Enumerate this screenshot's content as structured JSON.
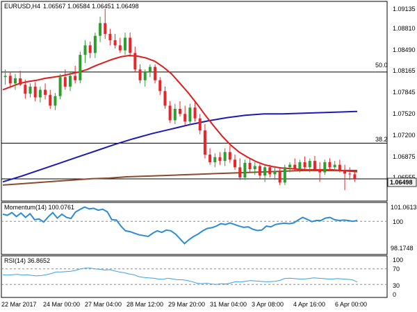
{
  "header": {
    "symbol": "EURUSD,H4",
    "ohlc": "1.06567 1.06584 1.06451 1.06498"
  },
  "colors": {
    "bull": "#2e9e2e",
    "bear": "#e8262a",
    "sma_fast": "#e01b1b",
    "sma_mid": "#1a1ab8",
    "sma_slow": "#8b4a2b",
    "indicator": "#2b8cd6",
    "rsi": "#3aa0e6",
    "price_box": "#f2f2f2"
  },
  "chart_data": [
    {
      "type": "candlestick",
      "title": "EURUSD,H4",
      "ylim": [
        1.0617,
        1.0927
      ],
      "y_ticks": [
        "1.09135",
        "1.08810",
        "1.08490",
        "1.08165",
        "1.07845",
        "1.07520",
        "1.07200",
        "1.06875",
        "1.06555"
      ],
      "current_price": "1.06498",
      "x_ticks": [
        "22 Mar 2017",
        "24 Mar 00:00",
        "27 Mar 04:00",
        "28 Mar 12:00",
        "29 Mar 20:00",
        "31 Mar 04:00",
        "3 Apr 08:00",
        "4 Apr 16:00",
        "6 Apr 00:00"
      ],
      "fib_levels": [
        {
          "label": "50.0",
          "value": 1.0818
        },
        {
          "label": "38.2",
          "value": 1.0706
        }
      ],
      "support_level": 1.06498,
      "candles": [
        [
          1.081,
          1.0822,
          1.0798,
          1.0812
        ],
        [
          1.0812,
          1.0818,
          1.0795,
          1.08
        ],
        [
          1.08,
          1.0815,
          1.079,
          1.0808
        ],
        [
          1.0808,
          1.082,
          1.0796,
          1.0798
        ],
        [
          1.0798,
          1.0806,
          1.0776,
          1.0784
        ],
        [
          1.0784,
          1.08,
          1.0778,
          1.0795
        ],
        [
          1.0795,
          1.0802,
          1.0772,
          1.0778
        ],
        [
          1.0778,
          1.0795,
          1.077,
          1.079
        ],
        [
          1.079,
          1.08,
          1.0775,
          1.0782
        ],
        [
          1.0782,
          1.079,
          1.076,
          1.0765
        ],
        [
          1.0765,
          1.0785,
          1.0758,
          1.078
        ],
        [
          1.078,
          1.0815,
          1.0775,
          1.081
        ],
        [
          1.081,
          1.0822,
          1.079,
          1.0795
        ],
        [
          1.0795,
          1.0818,
          1.0788,
          1.0812
        ],
        [
          1.0812,
          1.0828,
          1.08,
          1.0805
        ],
        [
          1.0805,
          1.085,
          1.08,
          1.0845
        ],
        [
          1.0845,
          1.0868,
          1.0832,
          1.086
        ],
        [
          1.086,
          1.0866,
          1.084,
          1.0848
        ],
        [
          1.0848,
          1.088,
          1.084,
          1.0875
        ],
        [
          1.0875,
          1.0905,
          1.0865,
          1.0895
        ],
        [
          1.0895,
          1.0918,
          1.087,
          1.0878
        ],
        [
          1.0878,
          1.0886,
          1.086,
          1.0868
        ],
        [
          1.0868,
          1.0878,
          1.0855,
          1.086
        ],
        [
          1.086,
          1.0872,
          1.0848,
          1.0852
        ],
        [
          1.0852,
          1.088,
          1.0845,
          1.0872
        ],
        [
          1.0872,
          1.088,
          1.0842,
          1.0848
        ],
        [
          1.0848,
          1.0858,
          1.0818,
          1.0822
        ],
        [
          1.0822,
          1.083,
          1.08,
          1.0805
        ],
        [
          1.0805,
          1.0822,
          1.0795,
          1.0818
        ],
        [
          1.0818,
          1.083,
          1.081,
          1.0826
        ],
        [
          1.0826,
          1.083,
          1.08,
          1.0805
        ],
        [
          1.0805,
          1.081,
          1.0782,
          1.0788
        ],
        [
          1.0788,
          1.0795,
          1.076,
          1.0765
        ],
        [
          1.0765,
          1.0772,
          1.0738,
          1.0742
        ],
        [
          1.0742,
          1.0768,
          1.0736,
          1.076
        ],
        [
          1.076,
          1.0772,
          1.0748,
          1.0752
        ],
        [
          1.0752,
          1.0765,
          1.0734,
          1.074
        ],
        [
          1.074,
          1.0768,
          1.0735,
          1.0762
        ],
        [
          1.0762,
          1.077,
          1.074,
          1.0745
        ],
        [
          1.0745,
          1.0752,
          1.072,
          1.0726
        ],
        [
          1.0726,
          1.0736,
          1.0682,
          1.0688
        ],
        [
          1.0688,
          1.0698,
          1.0672,
          1.0676
        ],
        [
          1.0676,
          1.069,
          1.0668,
          1.0684
        ],
        [
          1.0684,
          1.0692,
          1.0672,
          1.0678
        ],
        [
          1.0678,
          1.0698,
          1.067,
          1.0692
        ],
        [
          1.0692,
          1.0702,
          1.0675,
          1.068
        ],
        [
          1.068,
          1.0688,
          1.0664,
          1.0668
        ],
        [
          1.0668,
          1.0682,
          1.0648,
          1.0652
        ],
        [
          1.0652,
          1.068,
          1.0648,
          1.0675
        ],
        [
          1.0675,
          1.0682,
          1.066,
          1.0665
        ],
        [
          1.0665,
          1.0676,
          1.0656,
          1.067
        ],
        [
          1.067,
          1.0676,
          1.065,
          1.0655
        ],
        [
          1.0655,
          1.0672,
          1.0645,
          1.0668
        ],
        [
          1.0668,
          1.0672,
          1.0652,
          1.0657
        ],
        [
          1.0657,
          1.067,
          1.0648,
          1.0662
        ],
        [
          1.0662,
          1.0668,
          1.064,
          1.0644
        ],
        [
          1.0644,
          1.0672,
          1.064,
          1.0668
        ],
        [
          1.0668,
          1.0676,
          1.066,
          1.0672
        ],
        [
          1.0672,
          1.0682,
          1.0662,
          1.0666
        ],
        [
          1.0666,
          1.068,
          1.066,
          1.0676
        ],
        [
          1.0676,
          1.0685,
          1.0664,
          1.0668
        ],
        [
          1.0668,
          1.0682,
          1.066,
          1.0678
        ],
        [
          1.0678,
          1.0686,
          1.0662,
          1.0665
        ],
        [
          1.0665,
          1.0676,
          1.0645,
          1.066
        ],
        [
          1.066,
          1.068,
          1.0656,
          1.0676
        ],
        [
          1.0676,
          1.0682,
          1.0664,
          1.0668
        ],
        [
          1.0668,
          1.0678,
          1.0662,
          1.0672
        ],
        [
          1.0672,
          1.068,
          1.066,
          1.0664
        ],
        [
          1.0664,
          1.0672,
          1.0632,
          1.0658
        ],
        [
          1.0658,
          1.0668,
          1.0648,
          1.0657
        ],
        [
          1.0657,
          1.0662,
          1.0645,
          1.065
        ]
      ],
      "series": [
        {
          "values": [
            1.079,
            1.0795,
            1.08,
            1.0803,
            1.0805,
            1.0808,
            1.081,
            1.0812,
            1.0815,
            1.0818,
            1.0822,
            1.0828,
            1.0833,
            1.0838,
            1.0842,
            1.0844,
            1.0843,
            1.084,
            1.0835,
            1.0826,
            1.0815,
            1.08,
            1.0785,
            1.0768,
            1.075,
            1.0733,
            1.0717,
            1.0703,
            1.0692,
            1.0684,
            1.0677,
            1.0672,
            1.0669,
            1.0667,
            1.0666,
            1.0665,
            1.0664,
            1.0664,
            1.0664,
            1.0664,
            1.0663,
            1.0662,
            1.0661
          ]
        },
        {
          "values": [
            1.0645,
            1.0654,
            1.0664,
            1.0674,
            1.0684,
            1.0694,
            1.0704,
            1.0713,
            1.0721,
            1.0728,
            1.0735,
            1.0741,
            1.0746,
            1.075,
            1.0752,
            1.0752,
            1.0753,
            1.0754,
            1.0755,
            1.0756
          ]
        },
        {
          "values": [
            1.064,
            1.0642,
            1.0644,
            1.0646,
            1.0648,
            1.065,
            1.0651,
            1.0653,
            1.0654,
            1.0655,
            1.0656,
            1.0657,
            1.0658,
            1.0659,
            1.066,
            1.0661,
            1.0662,
            1.0663,
            1.0663,
            1.0663,
            1.0663
          ]
        }
      ]
    },
    {
      "type": "line",
      "title": "Momentum(14) 100.0761",
      "ylim": [
        98.0,
        101.1
      ],
      "y_ticks": [
        "101.0613",
        "100",
        "98.1748"
      ],
      "series": [
        {
          "values": [
            100.45,
            100.38,
            100.55,
            100.3,
            100.52,
            100.25,
            100.48,
            100.1,
            100.15,
            99.95,
            100.28,
            100.55,
            100.2,
            100.45,
            100.25,
            100.18,
            100.58,
            100.75,
            100.9,
            100.78,
            100.82,
            100.7,
            100.76,
            100.6,
            100.1,
            100.08,
            99.7,
            99.4,
            99.35,
            99.25,
            99.15,
            99.1,
            99.05,
            99.25,
            99.4,
            99.3,
            99.45,
            99.4,
            99.2,
            98.9,
            98.6,
            98.85,
            99.05,
            99.2,
            99.4,
            99.55,
            99.6,
            99.7,
            99.85,
            99.8,
            99.9,
            99.8,
            99.7,
            99.62,
            99.65,
            99.5,
            99.42,
            99.45,
            99.7,
            99.65,
            99.8,
            99.85,
            99.88,
            99.85,
            99.9,
            100.08,
            100.25,
            100.12,
            99.98,
            100.05,
            100.05,
            100.2,
            100.25,
            100.1,
            100.05,
            100.08,
            100.05,
            100.0,
            100.05
          ]
        }
      ]
    },
    {
      "type": "line",
      "title": "RSI(14) 36.8652",
      "ylim": [
        0,
        100
      ],
      "y_ticks": [
        "100",
        "70",
        "30",
        "0"
      ],
      "series": [
        {
          "values": [
            55,
            54,
            55,
            56,
            54,
            55,
            53,
            52,
            53,
            55,
            58,
            62,
            62,
            63,
            64,
            66,
            70,
            72,
            72,
            70,
            69,
            67,
            68,
            65,
            62,
            60,
            57,
            55,
            50,
            48,
            47,
            46,
            44,
            43,
            46,
            44,
            42,
            42,
            40,
            37,
            33,
            32,
            33,
            31,
            30,
            32,
            31,
            34,
            37,
            36,
            38,
            40,
            39,
            38,
            37,
            37,
            38,
            40,
            45,
            46,
            45,
            44,
            44,
            45,
            47,
            46,
            45,
            44,
            44,
            45,
            44,
            43,
            42,
            36
          ]
        }
      ]
    }
  ]
}
